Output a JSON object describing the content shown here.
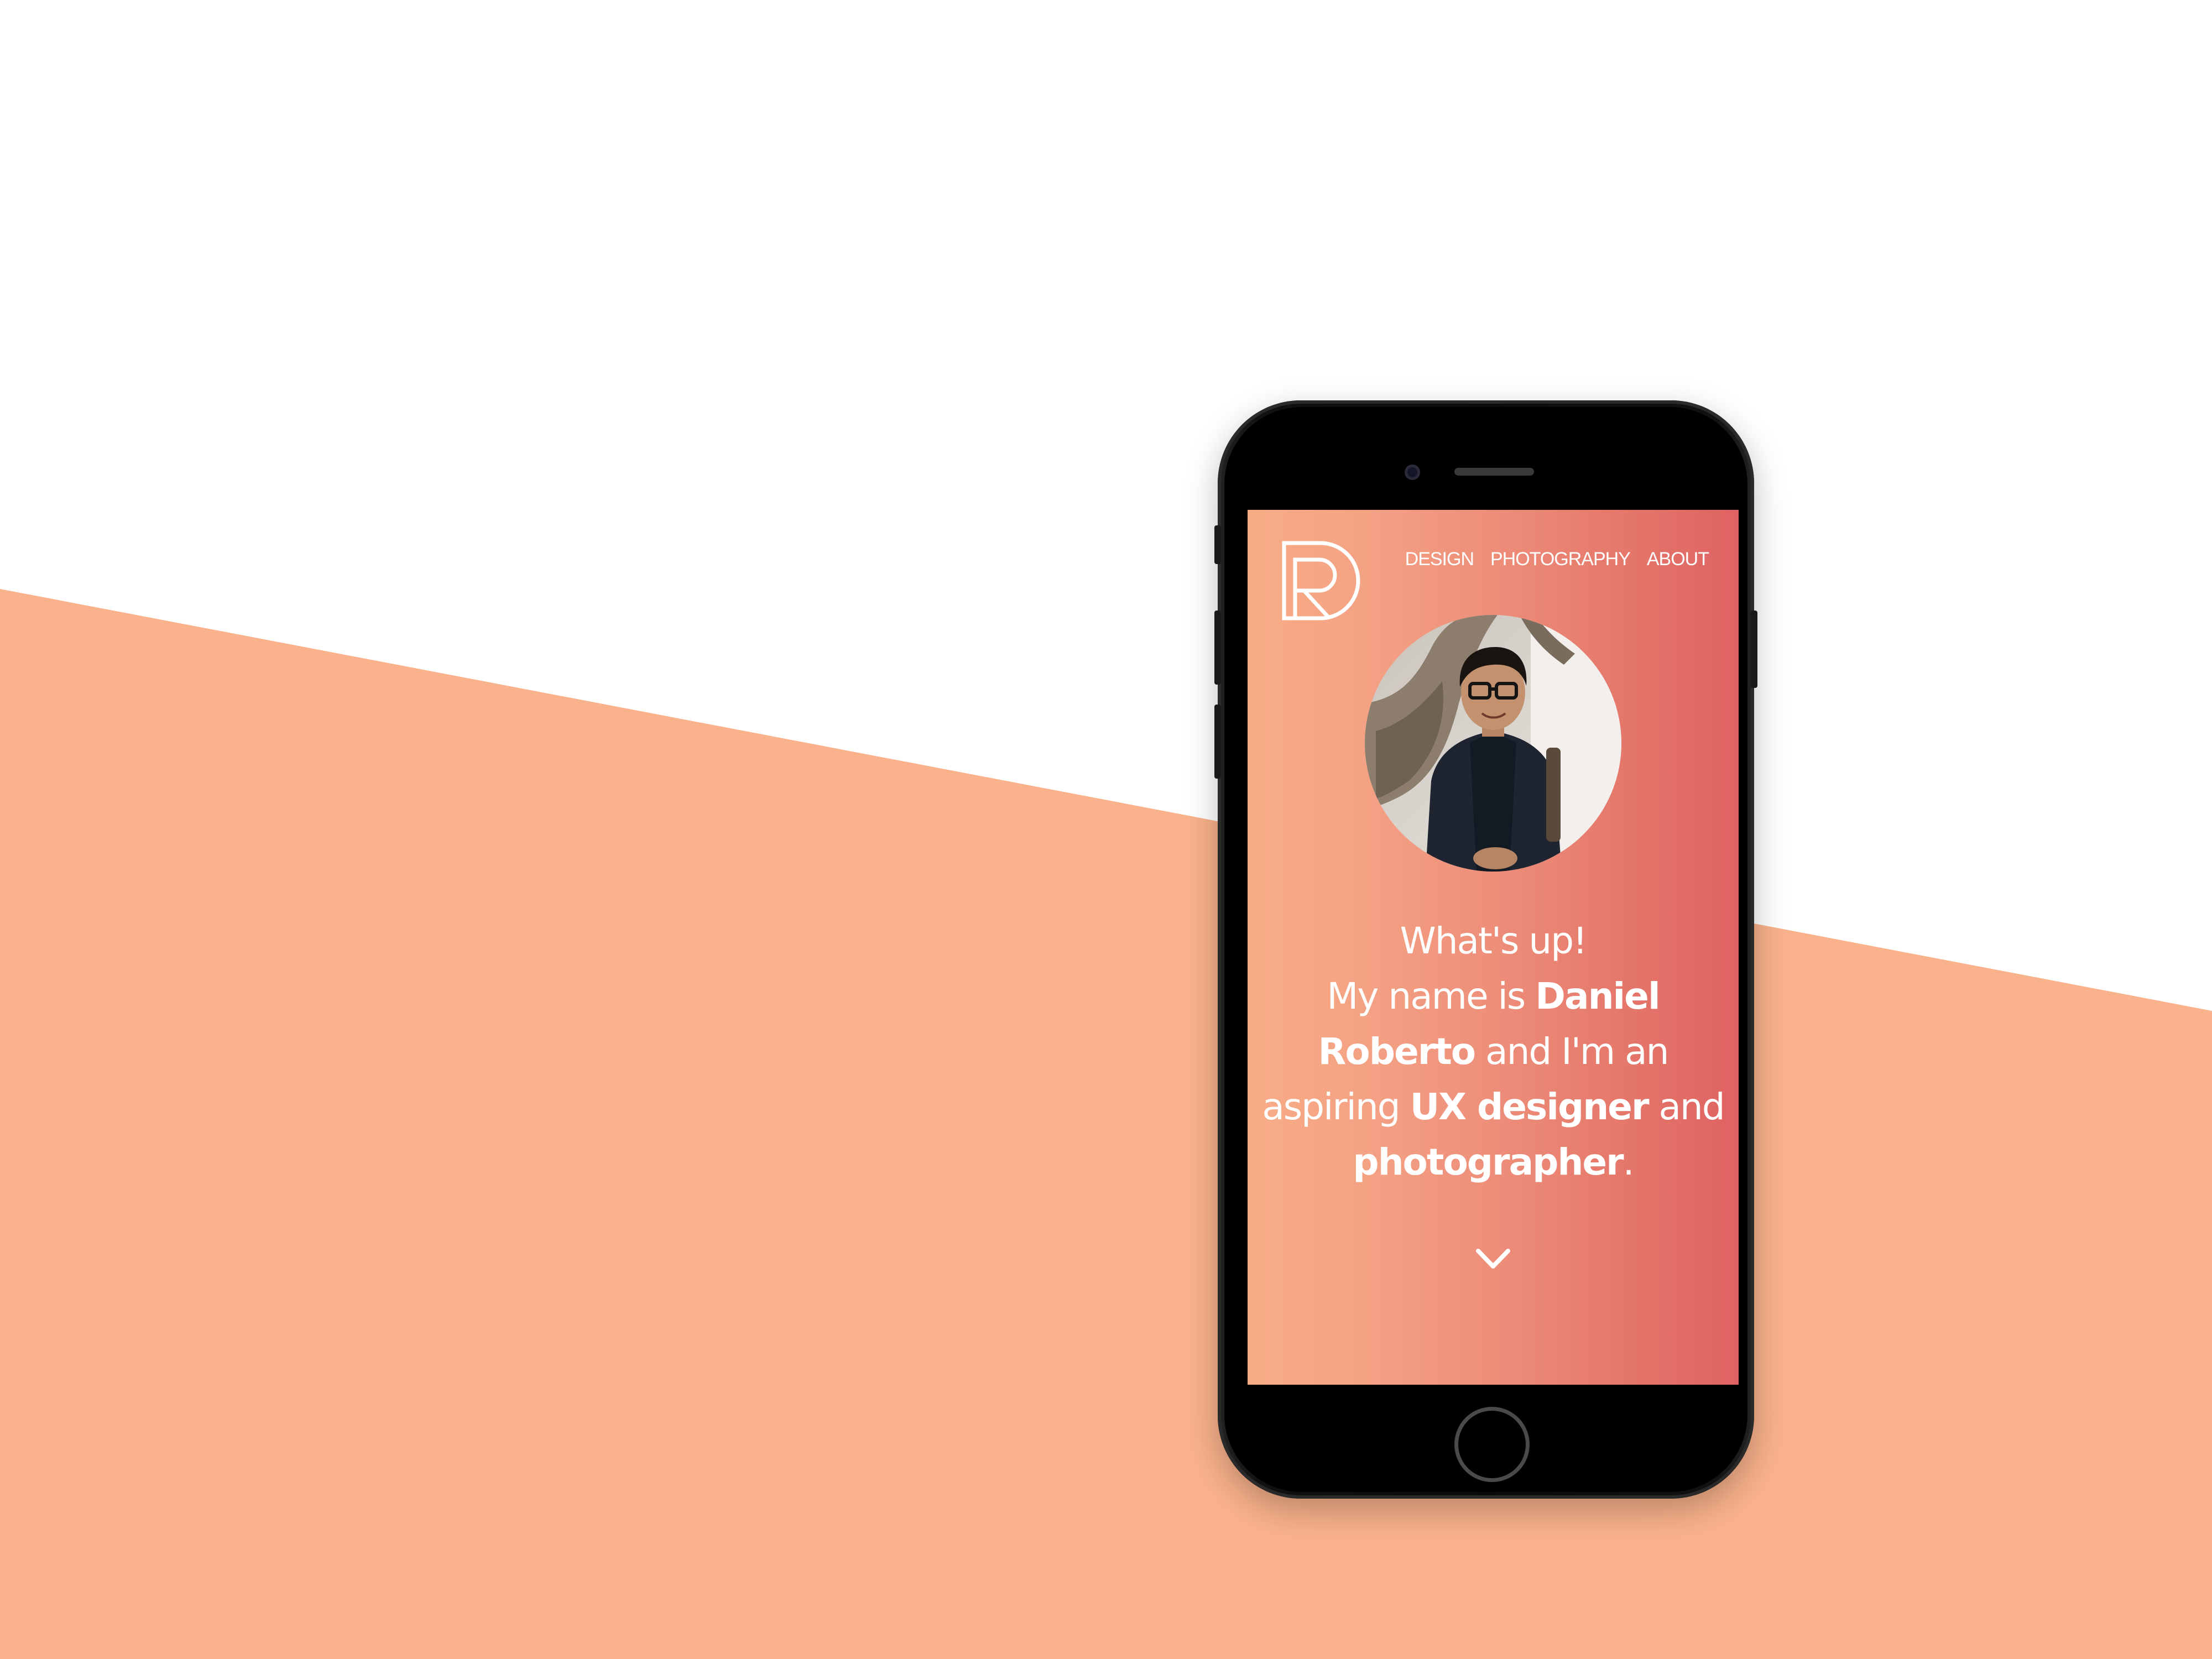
{
  "colors": {
    "background_top": "#ffffff",
    "background_band": "#f9b28b",
    "screen_gradient_start": "#f8ad86",
    "screen_gradient_end": "#df6262",
    "text": "#ffffff",
    "phone_body": "#0b0b0b"
  },
  "brand": {
    "logo_icon": "dr-monogram-icon"
  },
  "nav": {
    "items": [
      {
        "label": "DESIGN"
      },
      {
        "label": "PHOTOGRAPHY"
      },
      {
        "label": "ABOUT"
      }
    ]
  },
  "hero": {
    "greeting": "What's up!",
    "line_prefix": "My name is",
    "name": "Daniel Roberto",
    "line_middle": "and I'm an aspiring",
    "role_1": "UX designer",
    "conjunction": "and",
    "role_2": "photographer",
    "period": "."
  },
  "icons": {
    "scroll": "chevron-down-icon",
    "avatar": "profile-photo"
  }
}
